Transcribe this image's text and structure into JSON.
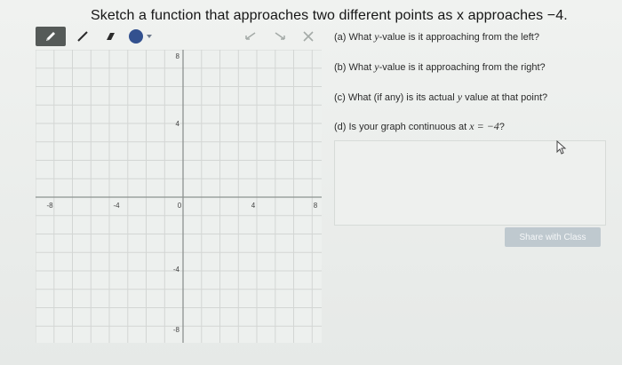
{
  "prompt": {
    "title": "Sketch a function that approaches two different points as x approaches −4."
  },
  "toolbar": {
    "tools": [
      {
        "name": "pencil-icon",
        "active": true
      },
      {
        "name": "line-icon"
      },
      {
        "name": "eraser-icon"
      },
      {
        "name": "color-picker-icon",
        "color": "#33518f"
      },
      {
        "name": "undo-icon"
      },
      {
        "name": "redo-icon"
      },
      {
        "name": "clear-icon"
      }
    ]
  },
  "graph": {
    "x_ticks": [
      "-8",
      "-4",
      "0",
      "4",
      "8"
    ],
    "y_ticks_top": "8",
    "y_tick_4": "4",
    "y_tick_neg4": "-4",
    "y_tick_neg8": "-8",
    "grid_color": "#d3d6d4",
    "axis_color": "#8d9290"
  },
  "questions": {
    "a_label": "(a) What",
    "a_var": "y",
    "a_rest": "-value is it approaching from the left?",
    "b_label": "(b) What",
    "b_var": "y",
    "b_rest": "-value is it approaching from the right?",
    "c_text": "(c) What (if any) is its actual",
    "c_var": "y",
    "c_rest": "value at that point?",
    "d_text": "(d) Is your graph continuous at",
    "d_expr": "x = −4",
    "d_q": "?"
  },
  "answer": {
    "value": ""
  },
  "share": {
    "label": "Share with Class"
  },
  "colors": {
    "brush": "#33518f",
    "button": "#bfc9cf"
  }
}
